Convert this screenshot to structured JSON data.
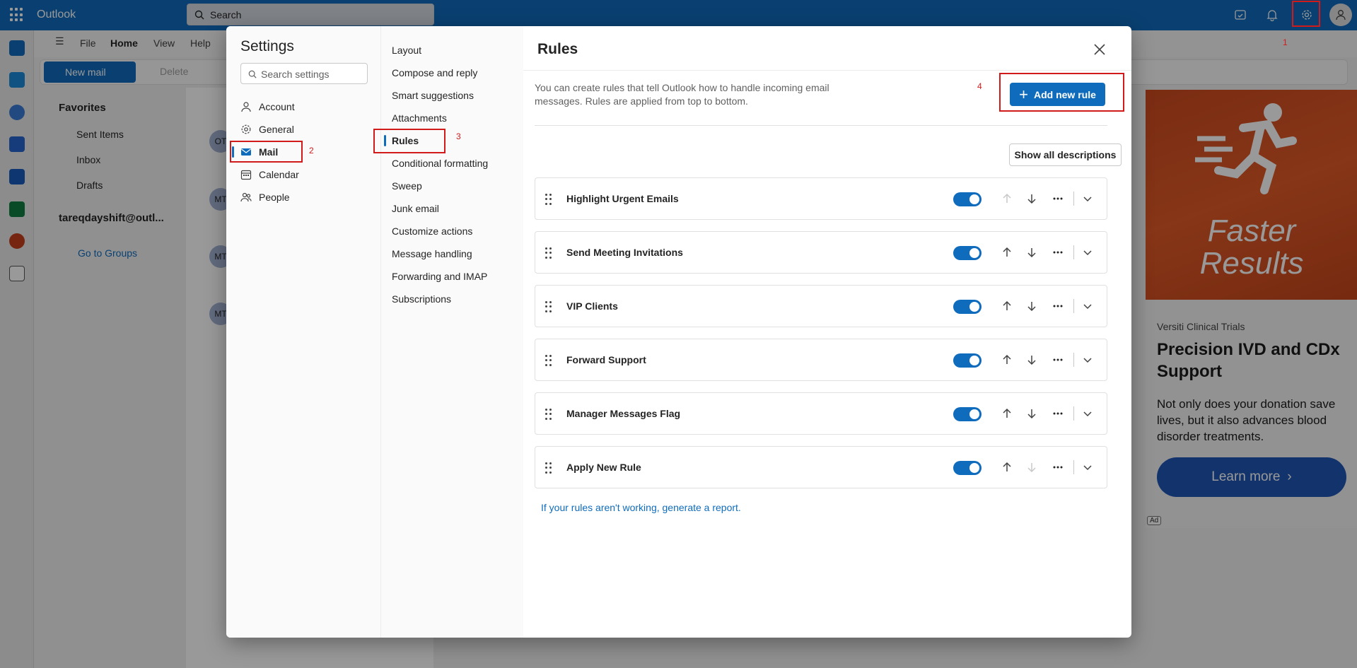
{
  "app": {
    "name": "Outlook",
    "search_placeholder": "Search"
  },
  "ribbon": {
    "tabs": [
      "File",
      "Home",
      "View",
      "Help"
    ],
    "new_mail": "New mail",
    "delete": "Delete"
  },
  "folders": {
    "favorites_label": "Favorites",
    "items": [
      "Sent Items",
      "Inbox",
      "Drafts"
    ],
    "account": "tareqdayshift@outl...",
    "groups": "Go to Groups"
  },
  "message_list": {
    "avatars": [
      "OT",
      "MT",
      "MT",
      "MT"
    ]
  },
  "ad": {
    "headline_line1": "Faster",
    "headline_line2": "Results",
    "sponsor": "Versiti Clinical Trials",
    "title": "Precision IVD and CDx Support",
    "description": "Not only does your donation save lives, but it also advances blood disorder treatments.",
    "cta": "Learn more",
    "badge": "Ad"
  },
  "settings": {
    "title": "Settings",
    "search_placeholder": "Search settings",
    "categories": [
      {
        "label": "Account",
        "icon": "person-icon"
      },
      {
        "label": "General",
        "icon": "gear-icon"
      },
      {
        "label": "Mail",
        "icon": "mail-icon"
      },
      {
        "label": "Calendar",
        "icon": "calendar-icon"
      },
      {
        "label": "People",
        "icon": "people-icon"
      }
    ],
    "mail_subcategories": [
      "Layout",
      "Compose and reply",
      "Smart suggestions",
      "Attachments",
      "Rules",
      "Conditional formatting",
      "Sweep",
      "Junk email",
      "Customize actions",
      "Message handling",
      "Forwarding and IMAP",
      "Subscriptions"
    ],
    "active_category": "Mail",
    "active_subcategory": "Rules"
  },
  "rules_page": {
    "title": "Rules",
    "description": "You can create rules that tell Outlook how to handle incoming email messages. Rules are applied from top to bottom.",
    "add_button": "Add new rule",
    "show_descriptions": "Show all descriptions",
    "rules": [
      {
        "name": "Highlight Urgent Emails",
        "enabled": true,
        "can_move_up": false,
        "can_move_down": true
      },
      {
        "name": "Send Meeting Invitations",
        "enabled": true,
        "can_move_up": true,
        "can_move_down": true
      },
      {
        "name": "VIP Clients",
        "enabled": true,
        "can_move_up": true,
        "can_move_down": true
      },
      {
        "name": "Forward Support",
        "enabled": true,
        "can_move_up": true,
        "can_move_down": true
      },
      {
        "name": "Manager Messages Flag",
        "enabled": true,
        "can_move_up": true,
        "can_move_down": true
      },
      {
        "name": "Apply New Rule",
        "enabled": true,
        "can_move_up": true,
        "can_move_down": false
      }
    ],
    "report_link": "If your rules aren't working, generate a report."
  },
  "annotations": [
    "1",
    "2",
    "3",
    "4"
  ],
  "colors": {
    "brand": "#0f6cbd",
    "annotation": "#d11a1a",
    "ad_bg": "#e15a27",
    "ad_button": "#1e55b3"
  }
}
